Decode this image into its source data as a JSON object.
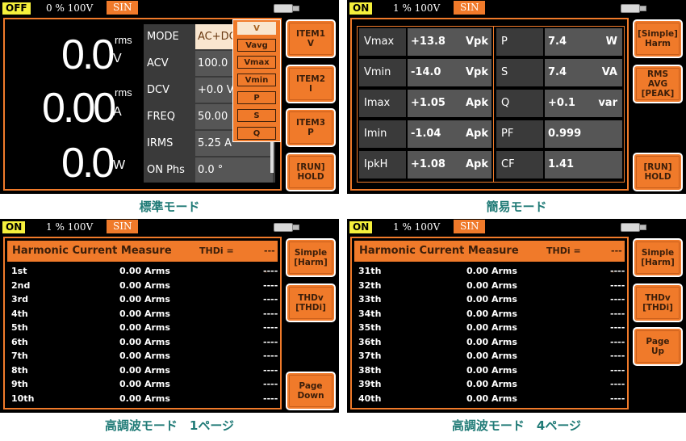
{
  "colors": {
    "accent": "#f07a2a",
    "off_badge": "#f5f03c",
    "caption": "#1f7a76"
  },
  "icons": {
    "usb": "usb-drive-icon"
  },
  "panel1": {
    "status": {
      "state": "OFF",
      "range": "0 % 100V",
      "wave": "SIN"
    },
    "voltage": {
      "value": "0.0",
      "unit_top": "rms",
      "unit": "V"
    },
    "current": {
      "value": "0.00",
      "unit_top": "rms",
      "unit": "A"
    },
    "power": {
      "value": "0.0",
      "unit": "W"
    },
    "settings": [
      {
        "label": "MODE",
        "value": "AC+DC"
      },
      {
        "label": "ACV",
        "value": "100.0"
      },
      {
        "label": "DCV",
        "value": "+0.0 V"
      },
      {
        "label": "FREQ",
        "value": "50.00"
      },
      {
        "label": "IRMS",
        "value": "5.25 A"
      },
      {
        "label": "ON Phs",
        "value": "0.0 °"
      }
    ],
    "dropdown": {
      "options": [
        "V",
        "Vavg",
        "Vmax",
        "Vmin",
        "P",
        "S",
        "Q"
      ],
      "selected": "V"
    },
    "buttons": [
      "ITEM1\nV",
      "ITEM2\nI",
      "ITEM3\nP",
      "[RUN]\nHOLD"
    ],
    "caption": "標準モード"
  },
  "panel2": {
    "status": {
      "state": "ON",
      "range": "1 % 100V",
      "wave": "SIN"
    },
    "rows": [
      {
        "l1": "Vmax",
        "v1": "+13.8",
        "u1": "Vpk",
        "l2": "P",
        "v2": "7.4",
        "u2": "W"
      },
      {
        "l1": "Vmin",
        "v1": "-14.0",
        "u1": "Vpk",
        "l2": "S",
        "v2": "7.4",
        "u2": "VA"
      },
      {
        "l1": "Imax",
        "v1": "+1.05",
        "u1": "Apk",
        "l2": "Q",
        "v2": "+0.1",
        "u2": "var"
      },
      {
        "l1": "Imin",
        "v1": "-1.04",
        "u1": "Apk",
        "l2": "PF",
        "v2": "0.999",
        "u2": ""
      },
      {
        "l1": "IpkH",
        "v1": "+1.08",
        "u1": "Apk",
        "l2": "CF",
        "v2": "1.41",
        "u2": ""
      }
    ],
    "buttons": [
      "[Simple]\nHarm",
      "RMS\nAVG\n[PEAK]",
      "[RUN]\nHOLD"
    ],
    "caption": "簡易モード"
  },
  "panel3": {
    "status": {
      "state": "ON",
      "range": "1 % 100V",
      "wave": "SIN"
    },
    "header": {
      "title": "Harmonic Current Measure",
      "thd_label": "THDi =",
      "thd_value": "----"
    },
    "rows": [
      {
        "order": "1st",
        "value": "0.00 Arms",
        "thd": "----"
      },
      {
        "order": "2nd",
        "value": "0.00 Arms",
        "thd": "----"
      },
      {
        "order": "3rd",
        "value": "0.00 Arms",
        "thd": "----"
      },
      {
        "order": "4th",
        "value": "0.00 Arms",
        "thd": "----"
      },
      {
        "order": "5th",
        "value": "0.00 Arms",
        "thd": "----"
      },
      {
        "order": "6th",
        "value": "0.00 Arms",
        "thd": "----"
      },
      {
        "order": "7th",
        "value": "0.00 Arms",
        "thd": "----"
      },
      {
        "order": "8th",
        "value": "0.00 Arms",
        "thd": "----"
      },
      {
        "order": "9th",
        "value": "0.00 Arms",
        "thd": "----"
      },
      {
        "order": "10th",
        "value": "0.00 Arms",
        "thd": "----"
      }
    ],
    "buttons": [
      "Simple\n[Harm]",
      "THDv\n[THDi]",
      "Page\nDown"
    ],
    "caption": "高調波モード　1ページ"
  },
  "panel4": {
    "status": {
      "state": "ON",
      "range": "1 % 100V",
      "wave": "SIN"
    },
    "header": {
      "title": "Harmonic Current Measure",
      "thd_label": "THDi =",
      "thd_value": "----"
    },
    "rows": [
      {
        "order": "31th",
        "value": "0.00 Arms",
        "thd": "----"
      },
      {
        "order": "32th",
        "value": "0.00 Arms",
        "thd": "----"
      },
      {
        "order": "33th",
        "value": "0.00 Arms",
        "thd": "----"
      },
      {
        "order": "34th",
        "value": "0.00 Arms",
        "thd": "----"
      },
      {
        "order": "35th",
        "value": "0.00 Arms",
        "thd": "----"
      },
      {
        "order": "36th",
        "value": "0.00 Arms",
        "thd": "----"
      },
      {
        "order": "37th",
        "value": "0.00 Arms",
        "thd": "----"
      },
      {
        "order": "38th",
        "value": "0.00 Arms",
        "thd": "----"
      },
      {
        "order": "39th",
        "value": "0.00 Arms",
        "thd": "----"
      },
      {
        "order": "40th",
        "value": "0.00 Arms",
        "thd": "----"
      }
    ],
    "buttons": [
      "Simple\n[Harm]",
      "THDv\n[THDi]",
      "Page\nUp"
    ],
    "caption": "高調波モード　4ページ"
  }
}
